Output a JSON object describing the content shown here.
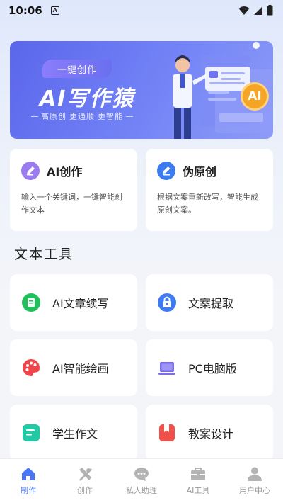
{
  "status_bar": {
    "time": "10:06",
    "notification_badge": "A"
  },
  "banner": {
    "tag": "一键创作",
    "title": "AI写作猿",
    "subtitle": [
      "高原创",
      "更通顺",
      "更智能"
    ],
    "ai_badge": "AI"
  },
  "feature_cards": [
    {
      "title": "AI创作",
      "description": "输入一个关键词，一键智能创作文本",
      "icon": "pen-icon",
      "color": "#9b7bf0"
    },
    {
      "title": "伪原创",
      "description": "根据文案重新改写，智能生成原创文案。",
      "icon": "edit-icon",
      "color": "#3d7bf0"
    }
  ],
  "section_title": "文本工具",
  "tools": [
    {
      "label": "AI文章续写",
      "icon": "document-icon",
      "color": "#1fc05a"
    },
    {
      "label": "文案提取",
      "icon": "lock-icon",
      "color": "#3d7bf0"
    },
    {
      "label": "AI智能绘画",
      "icon": "palette-icon",
      "color": "#f0464a"
    },
    {
      "label": "PC电脑版",
      "icon": "laptop-icon",
      "color": "#7a6cf0"
    },
    {
      "label": "学生作文",
      "icon": "notepad-icon",
      "color": "#22c9a5"
    },
    {
      "label": "教案设计",
      "icon": "bookmark-icon",
      "color": "#f0504a"
    }
  ],
  "tab_bar": {
    "tabs": [
      {
        "label": "制作",
        "icon": "home-icon",
        "active": true
      },
      {
        "label": "创作",
        "icon": "tools-icon",
        "active": false
      },
      {
        "label": "私人助理",
        "icon": "chat-icon",
        "active": false
      },
      {
        "label": "AI工具",
        "icon": "toolbox-icon",
        "active": false
      },
      {
        "label": "用户中心",
        "icon": "user-icon",
        "active": false
      }
    ],
    "active_color": "#4a78f5",
    "inactive_color": "#b4b4b4"
  }
}
